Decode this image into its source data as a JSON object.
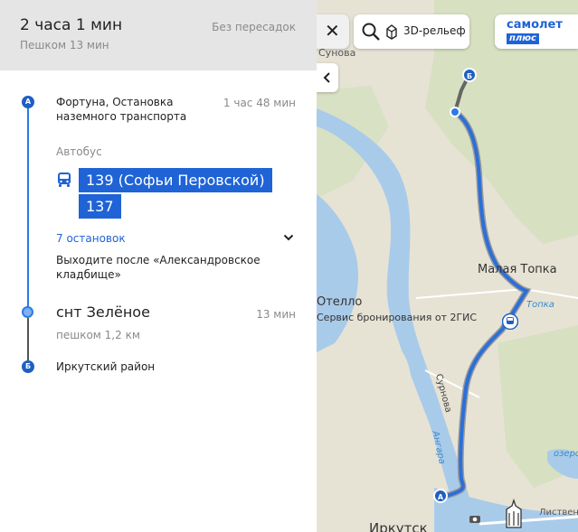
{
  "summary": {
    "duration": "2 часа 1 мин",
    "walk_total": "Пешком 13 мин",
    "transfers": "Без пересадок"
  },
  "route": {
    "start": {
      "marker": "А",
      "name_line1": "Фортуна, Остановка",
      "name_line2": "наземного транспорта",
      "time": "1 час 48 мин"
    },
    "transport_type": "Автобус",
    "buses": [
      "139 (Софьи Перовской)",
      "137"
    ],
    "stops_count": "7 остановок",
    "exit_line1": "Выходите после «Александровское",
    "exit_line2": "кладбище»",
    "mid_stop": {
      "name": "снт Зелёное",
      "time": "13 мин"
    },
    "walk": "пешком 1,2 км",
    "end": {
      "marker": "Б",
      "name": "Иркутский район"
    }
  },
  "map": {
    "close_glyph": "✕",
    "collapse_glyph": "‹",
    "relief_label": "3D-рельеф",
    "promo_line1": "самолет",
    "promo_line2": "плюс",
    "labels": {
      "top_cut": "Сунова",
      "town": "Малая Топка",
      "river_top": "Топка",
      "poi_name": "Отелло",
      "poi_desc": "Сервис бронирования от 2ГИС",
      "road_surnova": "Сурнова",
      "river_angara": "Ангара",
      "lake": "озеро",
      "street": "Лиственичный",
      "city": "Иркутск"
    },
    "marker_a": "А",
    "marker_b": "Б"
  },
  "colors": {
    "accent": "#1f63d6",
    "route_line": "#2c7be5",
    "water": "#a9cbea",
    "land": "#e6e3d5",
    "forest": "#d7e0c1"
  }
}
